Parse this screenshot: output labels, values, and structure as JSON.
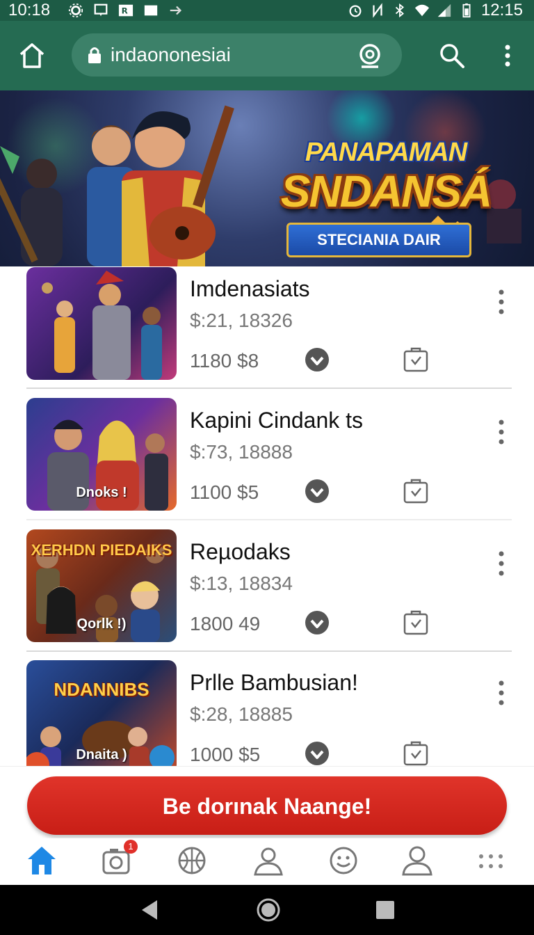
{
  "status_bar": {
    "time": "10:18",
    "clock_right": "12:15"
  },
  "browser": {
    "url": "indaononesiai",
    "icons": [
      "home-icon",
      "lock-icon",
      "camera-icon",
      "search-icon",
      "more-vert-icon"
    ]
  },
  "hero": {
    "line1": "PANAPAMAN",
    "line2": "SNDANSÁ",
    "ribbon": "STECIANIA DAIR"
  },
  "items": [
    {
      "title": "Imdenasiats",
      "price": "$:21, 18326",
      "meta": "1180 $8",
      "thumb_caption": "",
      "thumb_banner": ""
    },
    {
      "title": "Kapini Cindank ts",
      "price": "$:73, 18888",
      "meta": "1100 $5",
      "thumb_caption": "Dnoks !",
      "thumb_banner": ""
    },
    {
      "title": "Reµodaks",
      "price": "$:13, 18834",
      "meta": "1800 49",
      "thumb_caption": "Qorlk !)",
      "thumb_banner": "XERHDN PIEDAIKS"
    },
    {
      "title": "Prlle Bambusian!",
      "price": "$:28, 18885",
      "meta": "1000 $5",
      "thumb_caption": "Dnaita )",
      "thumb_banner": "NDANNIBS"
    }
  ],
  "cta": {
    "label": "Be dorınak Naange!"
  },
  "bottom_nav": {
    "items": [
      "home-icon",
      "camera-icon",
      "basketball-icon",
      "person-icon",
      "smiley-icon",
      "profile-icon",
      "apps-icon"
    ],
    "badge": "1"
  },
  "colors": {
    "toolbar": "#256b52",
    "accent": "#1e88e5",
    "cta": "#d4261d"
  }
}
